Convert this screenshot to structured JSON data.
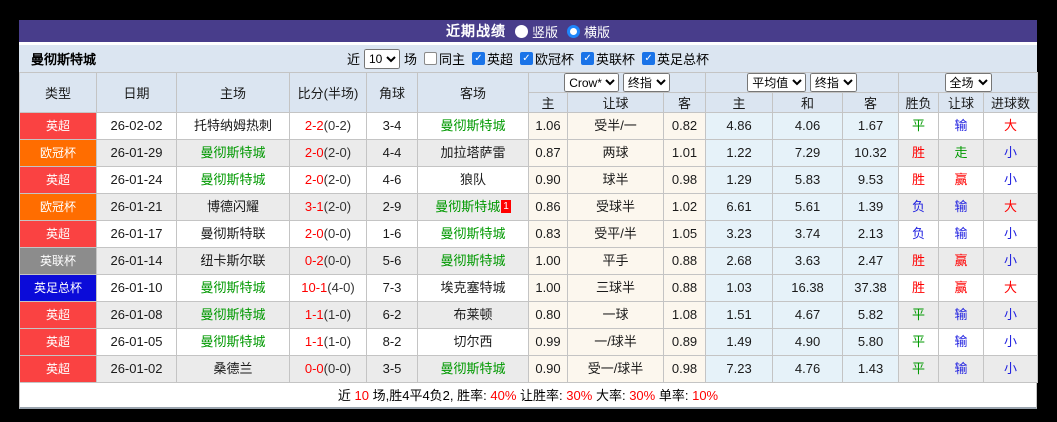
{
  "title_bar": {
    "title": "近期战绩",
    "vertical_label": "竖版",
    "horizontal_label": "横版"
  },
  "filter_bar": {
    "team_name": "曼彻斯特城",
    "near_label": "近",
    "count_value": "10",
    "games_label": "场",
    "same_home_label": "同主",
    "league_filters": [
      "英超",
      "欧冠杯",
      "英联杯",
      "英足总杯"
    ]
  },
  "table": {
    "left_headers": [
      "类型",
      "日期",
      "主场",
      "比分(半场)",
      "角球",
      "客场"
    ],
    "sub_headers": [
      "主",
      "让球",
      "客",
      "主",
      "和",
      "客",
      "胜负",
      "让球",
      "进球数"
    ],
    "selects": {
      "bookmaker": "Crow*",
      "crow_period": "终指",
      "average": "平均值",
      "avg_period": "终指",
      "scope": "全场"
    },
    "rows": [
      {
        "league": "英超",
        "league_bg": "#fa4242",
        "date": "26-02-02",
        "home": "托特纳姆热刺",
        "home_color": "#1a1a1a",
        "score": "2-2",
        "half": "(0-2)",
        "corners": "3-4",
        "away": "曼彻斯特城",
        "away_color": "#009900",
        "away_rc": "",
        "crow_home": "1.06",
        "handicap": "受半/一",
        "crow_away": "0.82",
        "avg_home": "4.86",
        "avg_draw": "4.06",
        "avg_away": "1.67",
        "result": "平",
        "result_color": "#009900",
        "cover": "输",
        "cover_color": "#1f1fe0",
        "goals": "大",
        "goals_color": "#ff0000"
      },
      {
        "league": "欧冠杯",
        "league_bg": "#ff6d00",
        "date": "26-01-29",
        "home": "曼彻斯特城",
        "home_color": "#009900",
        "score": "2-0",
        "half": "(2-0)",
        "corners": "4-4",
        "away": "加拉塔萨雷",
        "away_color": "#1a1a1a",
        "away_rc": "",
        "crow_home": "0.87",
        "handicap": "两球",
        "crow_away": "1.01",
        "avg_home": "1.22",
        "avg_draw": "7.29",
        "avg_away": "10.32",
        "result": "胜",
        "result_color": "#ff0000",
        "cover": "走",
        "cover_color": "#009900",
        "goals": "小",
        "goals_color": "#1f1fe0"
      },
      {
        "league": "英超",
        "league_bg": "#fa4242",
        "date": "26-01-24",
        "home": "曼彻斯特城",
        "home_color": "#009900",
        "score": "2-0",
        "half": "(2-0)",
        "corners": "4-6",
        "away": "狼队",
        "away_color": "#1a1a1a",
        "away_rc": "",
        "crow_home": "0.90",
        "handicap": "球半",
        "crow_away": "0.98",
        "avg_home": "1.29",
        "avg_draw": "5.83",
        "avg_away": "9.53",
        "result": "胜",
        "result_color": "#ff0000",
        "cover": "赢",
        "cover_color": "#ff0000",
        "goals": "小",
        "goals_color": "#1f1fe0"
      },
      {
        "league": "欧冠杯",
        "league_bg": "#ff6d00",
        "date": "26-01-21",
        "home": "博德闪耀",
        "home_color": "#1a1a1a",
        "score": "3-1",
        "half": "(2-0)",
        "corners": "2-9",
        "away": "曼彻斯特城",
        "away_color": "#009900",
        "away_rc": "1",
        "crow_home": "0.86",
        "handicap": "受球半",
        "crow_away": "1.02",
        "avg_home": "6.61",
        "avg_draw": "5.61",
        "avg_away": "1.39",
        "result": "负",
        "result_color": "#1f1fe0",
        "cover": "输",
        "cover_color": "#1f1fe0",
        "goals": "大",
        "goals_color": "#ff0000"
      },
      {
        "league": "英超",
        "league_bg": "#fa4242",
        "date": "26-01-17",
        "home": "曼彻斯特联",
        "home_color": "#1a1a1a",
        "score": "2-0",
        "half": "(0-0)",
        "corners": "1-6",
        "away": "曼彻斯特城",
        "away_color": "#009900",
        "away_rc": "",
        "crow_home": "0.83",
        "handicap": "受平/半",
        "crow_away": "1.05",
        "avg_home": "3.23",
        "avg_draw": "3.74",
        "avg_away": "2.13",
        "result": "负",
        "result_color": "#1f1fe0",
        "cover": "输",
        "cover_color": "#1f1fe0",
        "goals": "小",
        "goals_color": "#1f1fe0"
      },
      {
        "league": "英联杯",
        "league_bg": "#8c8c8c",
        "date": "26-01-14",
        "home": "纽卡斯尔联",
        "home_color": "#1a1a1a",
        "score": "0-2",
        "half": "(0-0)",
        "corners": "5-6",
        "away": "曼彻斯特城",
        "away_color": "#009900",
        "away_rc": "",
        "crow_home": "1.00",
        "handicap": "平手",
        "crow_away": "0.88",
        "avg_home": "2.68",
        "avg_draw": "3.63",
        "avg_away": "2.47",
        "result": "胜",
        "result_color": "#ff0000",
        "cover": "赢",
        "cover_color": "#ff0000",
        "goals": "小",
        "goals_color": "#1f1fe0"
      },
      {
        "league": "英足总杯",
        "league_bg": "#0b0bd9",
        "date": "26-01-10",
        "home": "曼彻斯特城",
        "home_color": "#009900",
        "score": "10-1",
        "half": "(4-0)",
        "corners": "7-3",
        "away": "埃克塞特城",
        "away_color": "#1a1a1a",
        "away_rc": "",
        "crow_home": "1.00",
        "handicap": "三球半",
        "crow_away": "0.88",
        "avg_home": "1.03",
        "avg_draw": "16.38",
        "avg_away": "37.38",
        "result": "胜",
        "result_color": "#ff0000",
        "cover": "赢",
        "cover_color": "#ff0000",
        "goals": "大",
        "goals_color": "#ff0000"
      },
      {
        "league": "英超",
        "league_bg": "#fa4242",
        "date": "26-01-08",
        "home": "曼彻斯特城",
        "home_color": "#009900",
        "score": "1-1",
        "half": "(1-0)",
        "corners": "6-2",
        "away": "布莱顿",
        "away_color": "#1a1a1a",
        "away_rc": "",
        "crow_home": "0.80",
        "handicap": "一球",
        "crow_away": "1.08",
        "avg_home": "1.51",
        "avg_draw": "4.67",
        "avg_away": "5.82",
        "result": "平",
        "result_color": "#009900",
        "cover": "输",
        "cover_color": "#1f1fe0",
        "goals": "小",
        "goals_color": "#1f1fe0"
      },
      {
        "league": "英超",
        "league_bg": "#fa4242",
        "date": "26-01-05",
        "home": "曼彻斯特城",
        "home_color": "#009900",
        "score": "1-1",
        "half": "(1-0)",
        "corners": "8-2",
        "away": "切尔西",
        "away_color": "#1a1a1a",
        "away_rc": "",
        "crow_home": "0.99",
        "handicap": "一/球半",
        "crow_away": "0.89",
        "avg_home": "1.49",
        "avg_draw": "4.90",
        "avg_away": "5.80",
        "result": "平",
        "result_color": "#009900",
        "cover": "输",
        "cover_color": "#1f1fe0",
        "goals": "小",
        "goals_color": "#1f1fe0"
      },
      {
        "league": "英超",
        "league_bg": "#fa4242",
        "date": "26-01-02",
        "home": "桑德兰",
        "home_color": "#1a1a1a",
        "score": "0-0",
        "half": "(0-0)",
        "corners": "3-5",
        "away": "曼彻斯特城",
        "away_color": "#009900",
        "away_rc": "",
        "crow_home": "0.90",
        "handicap": "受一/球半",
        "crow_away": "0.98",
        "avg_home": "7.23",
        "avg_draw": "4.76",
        "avg_away": "1.43",
        "result": "平",
        "result_color": "#009900",
        "cover": "输",
        "cover_color": "#1f1fe0",
        "goals": "小",
        "goals_color": "#1f1fe0"
      }
    ]
  },
  "footer": {
    "parts": [
      {
        "t": "近",
        "c": "#000000"
      },
      {
        "t": "10",
        "c": "#ff0000"
      },
      {
        "t": "场,胜4平4负2, 胜率:",
        "c": "#000000"
      },
      {
        "t": "40%",
        "c": "#ff0000"
      },
      {
        "t": " 让胜率:",
        "c": "#000000"
      },
      {
        "t": "30%",
        "c": "#ff0000"
      },
      {
        "t": " 大率:",
        "c": "#000000"
      },
      {
        "t": "30%",
        "c": "#ff0000"
      },
      {
        "t": " 单率:",
        "c": "#000000"
      },
      {
        "t": "10%",
        "c": "#ff0000"
      }
    ]
  },
  "colors": {
    "title_bar_bg": "#483d8b",
    "panel_bg": "#dbe5f1",
    "crow_col_bg": "#fcf7ee",
    "avg_col_bg": "#e6f2f9",
    "stripe_bg": "#ebebeb",
    "checkbox_blue": "#1a73e8",
    "radio_selected_blue": "#1e86fb",
    "team_green": "#009900",
    "win_red": "#ff0000",
    "lose_blue": "#1f1fe0"
  }
}
